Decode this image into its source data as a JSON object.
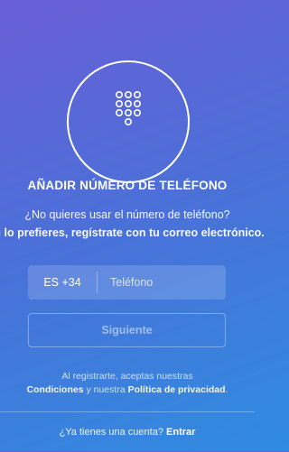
{
  "header": {
    "icon": "phone-keypad-icon",
    "title": "AÑADIR NÚMERO DE TELÉFONO",
    "subtitle_question": "¿No quieres usar el número de teléfono?",
    "subtitle_email": "Si lo prefieres, regístrate con tu correo electrónico."
  },
  "phone_input": {
    "country_code": "ES +34",
    "placeholder": "Teléfono",
    "value": ""
  },
  "next_button": {
    "label": "Siguiente"
  },
  "terms": {
    "line1": "Al registrarte, aceptas nuestras",
    "conditions": "Condiciones",
    "and": " y nuestra ",
    "policy": "Política de privacidad",
    "end": "."
  },
  "footer": {
    "question": "¿Ya tienes una cuenta?",
    "login": "Entrar"
  },
  "colors": {
    "gradient_top": "#6a5fd6",
    "gradient_bottom": "#2f8ce0"
  }
}
